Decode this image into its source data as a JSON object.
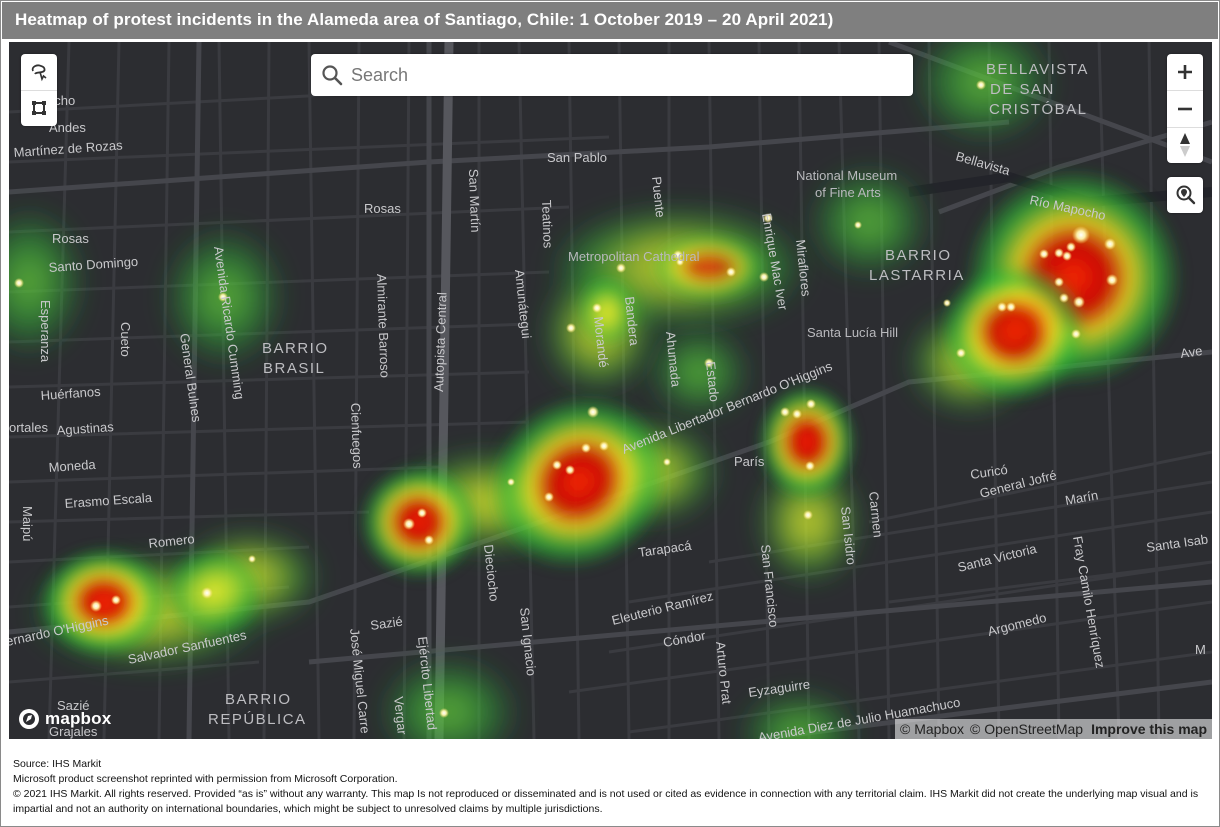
{
  "title": "Heatmap of protest incidents in the Alameda area of Santiago, Chile: 1 October 2019 – 20 April 2021)",
  "search": {
    "placeholder": "Search"
  },
  "controls": {
    "lasso_icon": "lasso-select-icon",
    "box_icon": "box-select-icon",
    "zoom_in_icon": "plus-icon",
    "zoom_out_icon": "minus-icon",
    "compass_icon": "compass-icon",
    "locate_icon": "geolocate-icon"
  },
  "brand": {
    "name": "mapbox"
  },
  "attribution": {
    "mapbox": "© Mapbox",
    "osm": "© OpenStreetMap",
    "improve": "Improve this map"
  },
  "map_labels": {
    "districts": {
      "bellavista1": "BELLAVISTA",
      "bellavista2": "DE SAN",
      "bellavista3": "CRISTÓBAL",
      "lastarria1": "BARRIO",
      "lastarria2": "LASTARRIA",
      "brasil1": "BARRIO",
      "brasil2": "BRASIL",
      "republica1": "BARRIO",
      "republica2": "REPÚBLICA"
    },
    "pois": {
      "museum1": "National Museum",
      "museum2": "of Fine Arts",
      "cathedral": "Metropolitan Cathedral",
      "santa_lucia": "Santa Lucía Hill"
    },
    "streets": {
      "ocho": "ocho",
      "andes": "Andes",
      "martinez": "Martínez de Rozas",
      "san_pablo": "San Pablo",
      "rosas_top": "Rosas",
      "rosas_left": "Rosas",
      "santo_domingo": "Santo Domingo",
      "esperanza": "Esperanza",
      "cueto": "Cueto",
      "huerfanos": "Huérfanos",
      "agustinas": "Agustinas",
      "moneda": "Moneda",
      "ortales": "ortales",
      "erasmo": "Erasmo Escala",
      "maipu": "Maipú",
      "romero": "Romero",
      "bernardo_left": "ernardo O'Higgins",
      "salvador": "Salvador Sanfuentes",
      "sazie_left": "Sazié",
      "grajales": "Grajales",
      "sazie_mid": "Sazié",
      "general_bulnes": "General Bulnes",
      "av_ricardo": "Avenida Ricardo Cumming",
      "almirante": "Almirante Barroso",
      "cienfuegos": "Cienfuegos",
      "autopista": "Autopista Central",
      "san_martin": "San Martín",
      "teatinos": "Teatinos",
      "amunategui": "Amunátegui",
      "morande": "Morandé",
      "bandera": "Bandera",
      "ahumada": "Ahumada",
      "estado": "Estado",
      "puente": "Puente",
      "enrique": "Enrique Mac Iver",
      "miraflores": "Miraflores",
      "bellavista_st": "Bellavista",
      "rio_mapocho": "Río Mapocho",
      "av_libertador": "Avenida Libertador Bernardo O'Higgins",
      "paris": "París",
      "san_isidro": "San Isidro",
      "carmen": "Carmen",
      "tarapaca": "Tarapacá",
      "dieciocho": "Dieciocho",
      "san_ignacio": "San Ignacio",
      "san_francisco": "San Francisco",
      "eleuterio": "Eleuterio Ramírez",
      "condor": "Cóndor",
      "arturo_prat": "Arturo Prat",
      "eyzaguirre": "Eyzaguirre",
      "jose_miguel": "José Miguel Carre",
      "ejercito": "Ejército Libertad",
      "vergara": "Vergar",
      "av_diez": "Avenida Diez de Julio Huamachuco",
      "curico": "Curicó",
      "general_jofre": "General Jofré",
      "marin": "Marín",
      "santa_victoria": "Santa Victoria",
      "argomedo": "Argomedo",
      "fray_camilo": "Fray Camilo Henríquez",
      "santa_isabel": "Santa Isab",
      "ave": "Ave",
      "m": "M"
    }
  },
  "heatmap_colors": {
    "low": "#2ecc40",
    "mid": "#f4e81a",
    "high": "#d10000",
    "point": "#fffbd0"
  },
  "footer": {
    "source": "Source: IHS Markit",
    "reprint": "Microsoft product screenshot reprinted with permission from Microsoft Corporation.",
    "copyright": "© 2021 IHS Markit. All rights reserved. Provided “as is” without any warranty. This map Is not reproduced or disseminated and is not used or cited as evidence in connection with any territorial claim. IHS Markit did not create the underlying map visual and is impartial and not an authority on international boundaries, which might be subject to unresolved claims by multiple jurisdictions."
  }
}
